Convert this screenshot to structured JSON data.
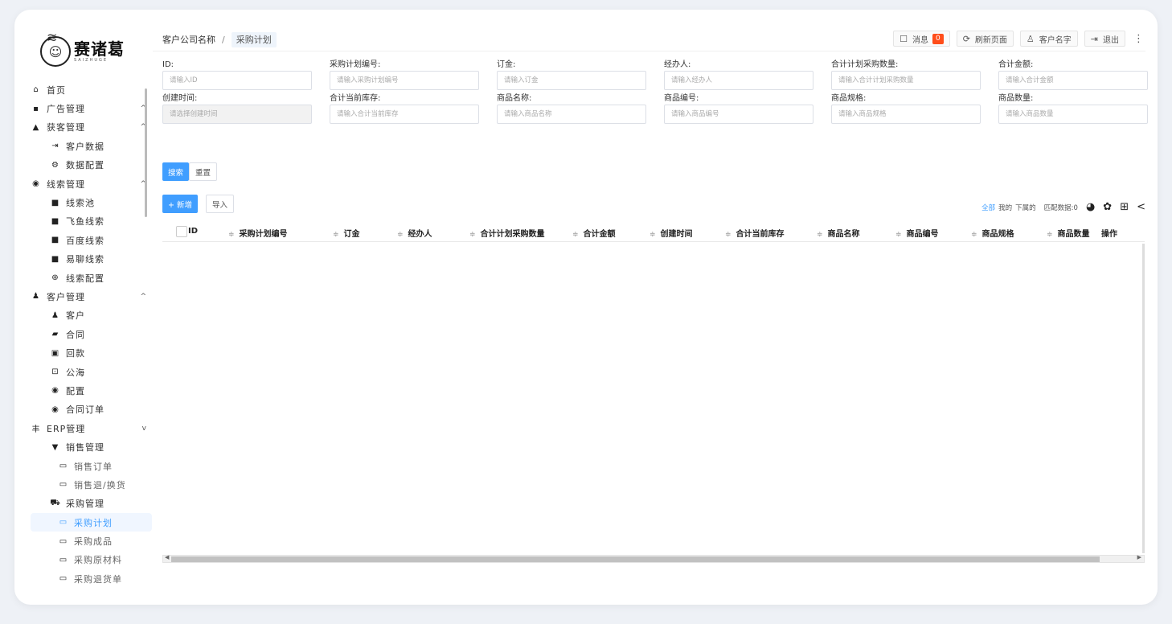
{
  "logo": {
    "cn": "赛诸葛",
    "en": "SAIZHUGE"
  },
  "sidebar": [
    {
      "level": 1,
      "icon": "⌂",
      "icon_name": "home-icon",
      "label": "首页"
    },
    {
      "level": 1,
      "icon": "▪",
      "icon_name": "ad-icon",
      "label": "广告管理",
      "arrow": "^"
    },
    {
      "level": 1,
      "icon": "▲",
      "icon_name": "acquire-icon",
      "label": "获客管理",
      "arrow": "^"
    },
    {
      "level": 2,
      "icon": "⇥",
      "icon_name": "customer-data-icon",
      "label": "客户数据"
    },
    {
      "level": 2,
      "icon": "⚙",
      "icon_name": "data-config-icon",
      "label": "数据配置"
    },
    {
      "level": 1,
      "icon": "◉",
      "icon_name": "leads-icon",
      "label": "线索管理",
      "arrow": "^"
    },
    {
      "level": 2,
      "icon": "■",
      "icon_name": "folder-icon",
      "label": "线索池"
    },
    {
      "level": 2,
      "icon": "■",
      "icon_name": "folder-icon",
      "label": "飞鱼线索"
    },
    {
      "level": 2,
      "icon": "■",
      "icon_name": "folder-icon",
      "label": "百度线索"
    },
    {
      "level": 2,
      "icon": "■",
      "icon_name": "folder-icon",
      "label": "易聊线索"
    },
    {
      "level": 2,
      "icon": "⊕",
      "icon_name": "leads-config-icon",
      "label": "线索配置"
    },
    {
      "level": 1,
      "icon": "♟",
      "icon_name": "customers-icon",
      "label": "客户管理",
      "arrow": "^"
    },
    {
      "level": 2,
      "icon": "♟",
      "icon_name": "customer-icon",
      "label": "客户"
    },
    {
      "level": 2,
      "icon": "▰",
      "icon_name": "contract-icon",
      "label": "合同"
    },
    {
      "level": 2,
      "icon": "▣",
      "icon_name": "payment-icon",
      "label": "回款"
    },
    {
      "level": 2,
      "icon": "⊡",
      "icon_name": "sea-icon",
      "label": "公海"
    },
    {
      "level": 2,
      "icon": "◉",
      "icon_name": "config-icon",
      "label": "配置"
    },
    {
      "level": 2,
      "icon": "◉",
      "icon_name": "contract-order-icon",
      "label": "合同订单"
    },
    {
      "level": 1,
      "icon": "丰",
      "icon_name": "erp-icon",
      "label": "ERP管理",
      "arrow": "v"
    },
    {
      "level": 2,
      "icon": "▼",
      "icon_name": "sales-icon",
      "label": "销售管理"
    },
    {
      "level": 3,
      "icon": "▭",
      "icon_name": "doc-icon",
      "label": "销售订单"
    },
    {
      "level": 3,
      "icon": "▭",
      "icon_name": "doc-icon",
      "label": "销售退/换货"
    },
    {
      "level": 2,
      "icon": "⛟",
      "icon_name": "cart-icon",
      "label": "采购管理"
    },
    {
      "level": 3,
      "icon": "▭",
      "icon_name": "doc-icon",
      "label": "采购计划",
      "active": true
    },
    {
      "level": 3,
      "icon": "▭",
      "icon_name": "doc-icon",
      "label": "采购成品"
    },
    {
      "level": 3,
      "icon": "▭",
      "icon_name": "doc-icon",
      "label": "采购原材料"
    },
    {
      "level": 3,
      "icon": "▭",
      "icon_name": "doc-icon",
      "label": "采购退货单"
    }
  ],
  "breadcrumb": {
    "root": "客户公司名称",
    "sep": "/",
    "current": "采购计划"
  },
  "topbar": {
    "message": "消息",
    "message_count": "0",
    "refresh": "刷新页面",
    "user": "客户名字",
    "logout": "退出",
    "more": "⋮"
  },
  "filters": [
    {
      "label": "ID:",
      "placeholder": "请输入ID"
    },
    {
      "label": "采购计划编号:",
      "placeholder": "请输入采购计划编号"
    },
    {
      "label": "订金:",
      "placeholder": "请输入订金"
    },
    {
      "label": "经办人:",
      "placeholder": "请输入经办人"
    },
    {
      "label": "合计计划采购数量:",
      "placeholder": "请输入合计计划采购数量"
    },
    {
      "label": "合计金额:",
      "placeholder": "请输入合计金额"
    },
    {
      "label": "创建时间:",
      "placeholder": "请选择创建时间",
      "disabled": true
    },
    {
      "label": "合计当前库存:",
      "placeholder": "请输入合计当前库存"
    },
    {
      "label": "商品名称:",
      "placeholder": "请输入商品名称"
    },
    {
      "label": "商品编号:",
      "placeholder": "请输入商品编号"
    },
    {
      "label": "商品规格:",
      "placeholder": "请输入商品规格"
    },
    {
      "label": "商品数量:",
      "placeholder": "请输入商品数量"
    }
  ],
  "buttons": {
    "search": "搜索",
    "reset": "重置",
    "add": "+ 新增",
    "import": "导入"
  },
  "tools": {
    "all": "全部",
    "mine": "我的",
    "sub": "下属的",
    "match": "匹配数据:0"
  },
  "columns": [
    "ID",
    "采购计划编号",
    "订金",
    "经办人",
    "合计计划采购数量",
    "合计金额",
    "创建时间",
    "合计当前库存",
    "商品名称",
    "商品编号",
    "商品规格",
    "商品数量",
    "操作"
  ]
}
